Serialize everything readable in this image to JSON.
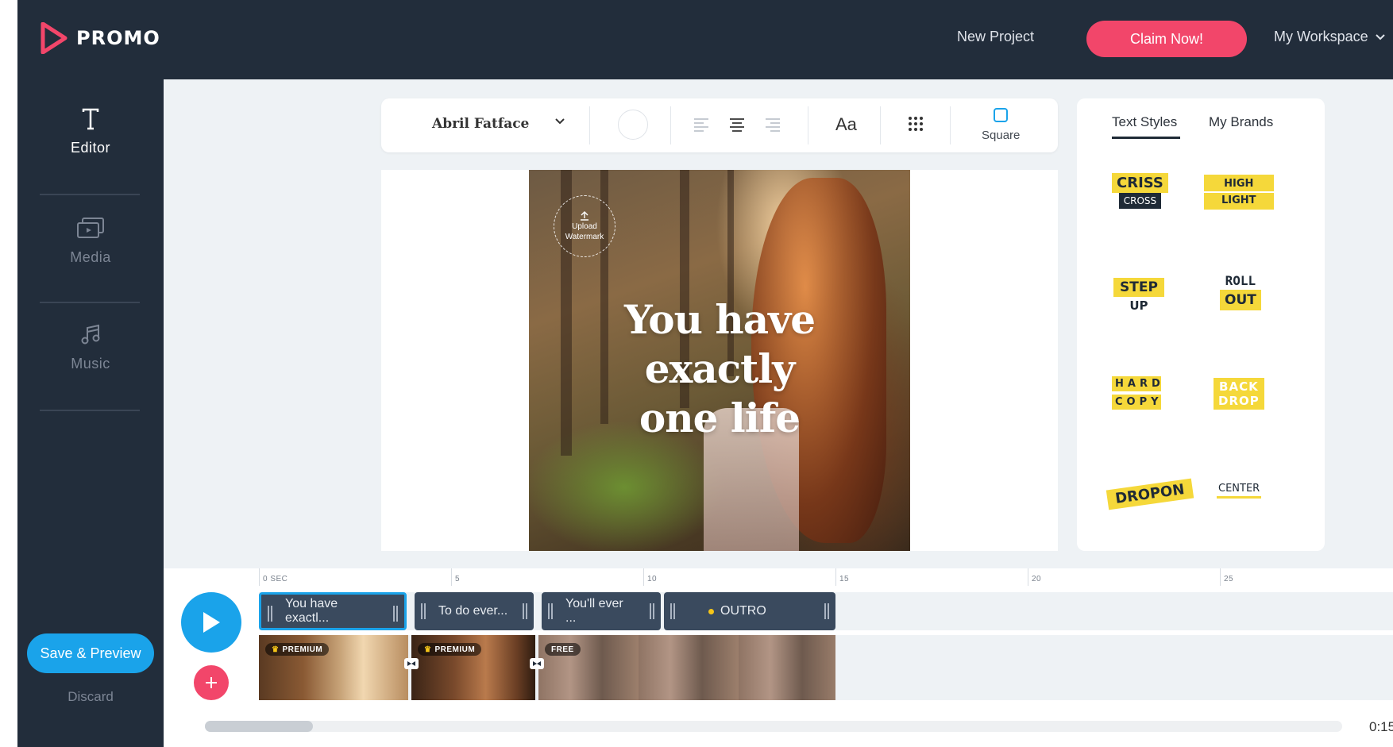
{
  "app": {
    "name": "PROMO"
  },
  "header": {
    "new_project": "New Project",
    "claim": "Claim Now!",
    "workspace": "My Workspace"
  },
  "sidebar": {
    "items": [
      {
        "label": "Editor",
        "icon": "text-icon",
        "active": true
      },
      {
        "label": "Media",
        "icon": "media-icon",
        "active": false
      },
      {
        "label": "Music",
        "icon": "music-icon",
        "active": false
      }
    ],
    "save_preview": "Save & Preview",
    "discard": "Discard"
  },
  "toolbar": {
    "font": "Abril Fatface",
    "case_label": "Aa",
    "aspect_label": "Square"
  },
  "canvas": {
    "watermark_line1": "Upload",
    "watermark_line2": "Watermark",
    "headline_lines": [
      "You have",
      "exactly",
      "one life"
    ]
  },
  "styles_panel": {
    "tabs": [
      "Text Styles",
      "My Brands"
    ],
    "styles": [
      {
        "top": "CRISS",
        "bottom": "CROSS"
      },
      {
        "top": "HIGH",
        "bottom": "LIGHT"
      },
      {
        "top": "STEP",
        "bottom": "UP"
      },
      {
        "top": "ROLL",
        "bottom": "OUT"
      },
      {
        "top": "HARD",
        "bottom": "COPY"
      },
      {
        "top": "BACK",
        "bottom": "DROP"
      },
      {
        "top": "DROPON",
        "bottom": ""
      },
      {
        "top": "CENTER",
        "bottom": ""
      }
    ]
  },
  "timeline": {
    "ticks": [
      "0 SEC",
      "5",
      "10",
      "15",
      "20",
      "25"
    ],
    "text_clips": [
      "You have exactl...",
      "To do ever...",
      "You'll ever ...",
      "OUTRO"
    ],
    "media_badges": [
      "PREMIUM",
      "PREMIUM",
      "FREE"
    ],
    "timecode": "0:15"
  },
  "colors": {
    "accent_blue": "#1aa3ea",
    "brand_pink": "#f2466a",
    "chrome_dark": "#222d3b",
    "style_yellow": "#f5d83a"
  }
}
